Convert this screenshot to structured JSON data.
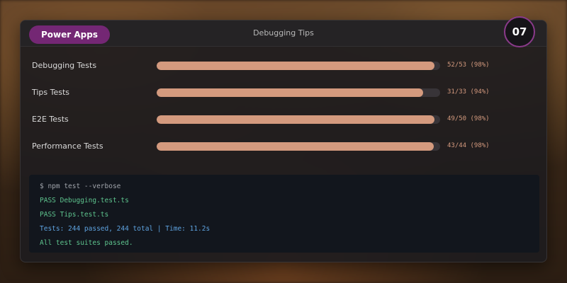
{
  "header": {
    "brand": "Power Apps",
    "title": "Debugging Tips",
    "slide_number": "07"
  },
  "colors": {
    "brand": "#742774",
    "bar_fill": "#d49a7e",
    "pass": "#5ec48e",
    "info": "#5ea3e0"
  },
  "tests": [
    {
      "label": "Debugging Tests",
      "passed": 52,
      "total": 53,
      "stat": "52/53 (98%)"
    },
    {
      "label": "Tips Tests",
      "passed": 31,
      "total": 33,
      "stat": "31/33 (94%)"
    },
    {
      "label": "E2E Tests",
      "passed": 49,
      "total": 50,
      "stat": "49/50 (98%)"
    },
    {
      "label": "Performance Tests",
      "passed": 43,
      "total": 44,
      "stat": "43/44 (98%)"
    }
  ],
  "terminal": {
    "lines": [
      {
        "text": "$ npm test --verbose",
        "kind": "cmd"
      },
      {
        "text": "PASS Debugging.test.ts",
        "kind": "pass"
      },
      {
        "text": "PASS Tips.test.ts",
        "kind": "pass"
      },
      {
        "text": "Tests: 244 passed, 244 total | Time: 11.2s",
        "kind": "info"
      },
      {
        "text": "All test suites passed.",
        "kind": "pass"
      }
    ]
  }
}
